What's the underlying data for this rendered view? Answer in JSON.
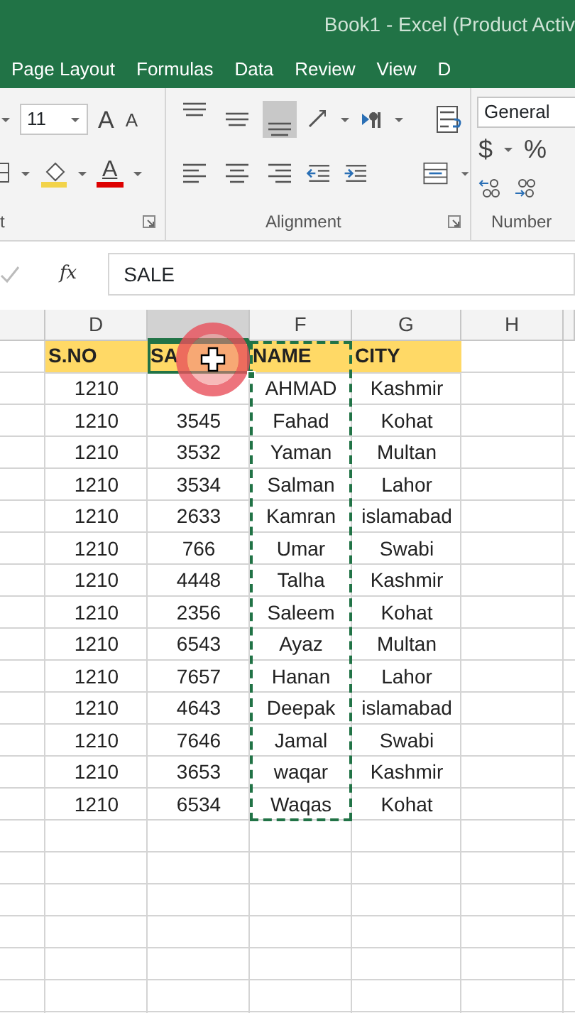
{
  "window": {
    "title": "Book1 - Excel (Product Activ"
  },
  "tabs": [
    {
      "label": "Page Layout",
      "selected": false
    },
    {
      "label": "Formulas",
      "selected": false
    },
    {
      "label": "Data",
      "selected": false
    },
    {
      "label": "Review",
      "selected": false
    },
    {
      "label": "View",
      "selected": false
    },
    {
      "label": "D",
      "selected": false
    }
  ],
  "ribbon": {
    "font_size": "11",
    "grow_font": "A",
    "shrink_font": "A",
    "font_color": "A",
    "font_group": "t",
    "alignment_group": "Alignment",
    "vertical_align": [
      {
        "selected": false
      },
      {
        "selected": false
      },
      {
        "selected": true
      }
    ],
    "number_format": "General",
    "currency": "$",
    "percent": "%",
    "number_group": "Number"
  },
  "formula_bar": {
    "function_label": "fx",
    "content": "SALE"
  },
  "sheet": {
    "columns": [
      {
        "label": "D",
        "selected": false
      },
      {
        "selected": true
      },
      {
        "label": "F",
        "selected": false,
        "marquee": true
      },
      {
        "label": "G",
        "selected": false
      },
      {
        "label": "H",
        "selected": false
      }
    ],
    "header_row": [
      "S.NO",
      "SA",
      "NAME",
      "CITY"
    ],
    "rows": [
      {
        "s_no": "1210",
        "name": "AHMAD",
        "city": "Kashmir"
      },
      {
        "s_no": "1210",
        "sale": "3545",
        "name": "Fahad",
        "city": "Kohat"
      },
      {
        "s_no": "1210",
        "sale": "3532",
        "name": "Yaman",
        "city": "Multan"
      },
      {
        "s_no": "1210",
        "sale": "3534",
        "name": "Salman",
        "city": "Lahor"
      },
      {
        "s_no": "1210",
        "sale": "2633",
        "name": "Kamran",
        "city": "islamabad"
      },
      {
        "s_no": "1210",
        "sale": "766",
        "name": "Umar",
        "city": "Swabi"
      },
      {
        "s_no": "1210",
        "sale": "4448",
        "name": "Talha",
        "city": "Kashmir"
      },
      {
        "s_no": "1210",
        "sale": "2356",
        "name": "Saleem",
        "city": "Kohat"
      },
      {
        "s_no": "1210",
        "sale": "6543",
        "name": "Ayaz",
        "city": "Multan"
      },
      {
        "s_no": "1210",
        "sale": "7657",
        "name": "Hanan",
        "city": "Lahor"
      },
      {
        "s_no": "1210",
        "sale": "4643",
        "name": "Deepak",
        "city": "islamabad"
      },
      {
        "s_no": "1210",
        "sale": "7646",
        "name": "Jamal",
        "city": "Swabi"
      },
      {
        "s_no": "1210",
        "sale": "3653",
        "name": "waqar",
        "city": "Kashmir"
      },
      {
        "s_no": "1210",
        "sale": "6534",
        "name": "Waqas",
        "city": "Kohat"
      }
    ]
  }
}
